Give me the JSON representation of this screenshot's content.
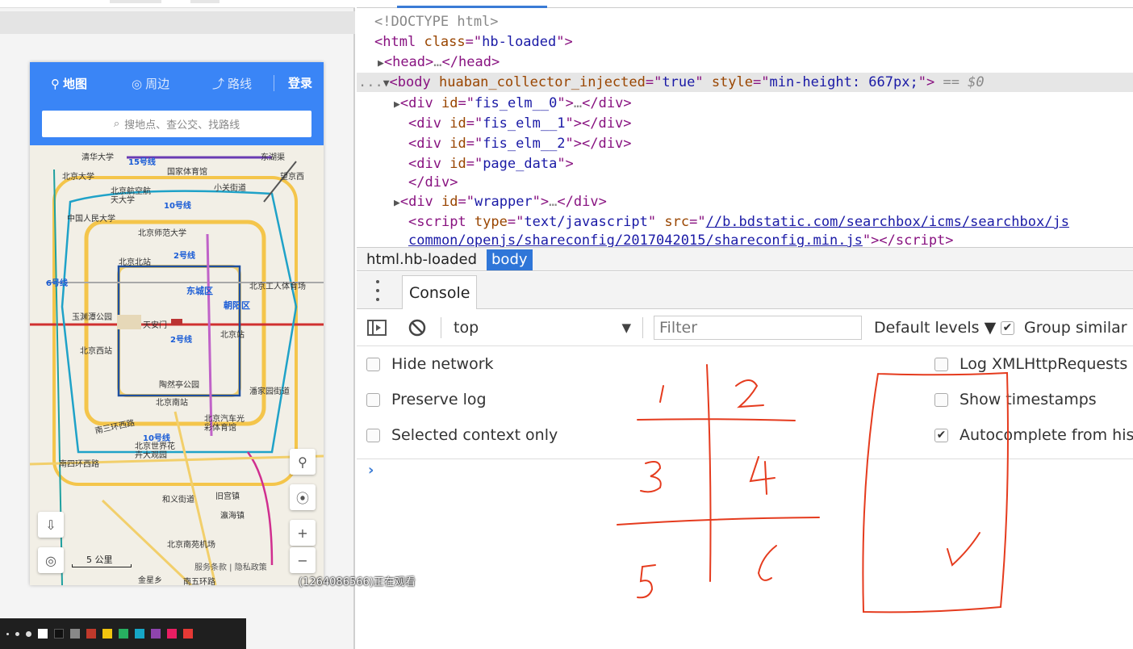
{
  "map": {
    "nav": {
      "map": "地图",
      "nearby": "周边",
      "route": "路线",
      "login": "登录"
    },
    "search_placeholder": "搜地点、查公交、找路线",
    "labels": [
      "清华大学",
      "15号线",
      "东湖渠",
      "北京大学",
      "国家体育馆",
      "望京西",
      "北京航空航天大学",
      "小关街道",
      "10号线",
      "中国人民大学",
      "北京师范大学",
      "北京北站",
      "2号线",
      "北京工人体育场",
      "东城区",
      "朝阳区",
      "6号线",
      "玉渊潭公园",
      "天安门",
      "北京站",
      "北京西站",
      "2号线",
      "陶然亭公园",
      "潘家园街道",
      "北京南站",
      "北京汽车光彩体育馆",
      "南三环西路",
      "10号线",
      "北京世界花卉大观园",
      "南四环西路",
      "和义街道",
      "旧宫镇",
      "瀛海镇",
      "北京南苑机场",
      "金星乡",
      "南五环路"
    ],
    "scale": "5 公里",
    "copyright": "服务条款 | 隐私政策"
  },
  "devtools": {
    "elements": {
      "doctype": "<!DOCTYPE html>",
      "html_open": {
        "tag": "html",
        "attr": "class",
        "value": "hb-loaded"
      },
      "head": {
        "tag": "head",
        "collapsed": "…"
      },
      "body": {
        "tag": "body",
        "attr1": "huaban_collector_injected",
        "val1": "true",
        "attr2": "style",
        "val2": "min-height: 667px;",
        "marker": "== $0",
        "ellipsis": "..."
      },
      "divs": [
        {
          "id": "fis_elm__0",
          "collapsed": true
        },
        {
          "id": "fis_elm__1",
          "collapsed": false
        },
        {
          "id": "fis_elm__2",
          "collapsed": false
        },
        {
          "id": "page_data",
          "collapsed": false
        },
        {
          "id": "wrapper",
          "collapsed": true
        }
      ],
      "script": {
        "type": "text/javascript",
        "src_line1": "//b.bdstatic.com/searchbox/icms/searchbox/js",
        "src_line2": "common/openjs/shareconfig/2017042015/shareconfig.min.js"
      }
    },
    "breadcrumbs": [
      "html.hb-loaded",
      "body"
    ],
    "console_tab": "Console",
    "toolbar": {
      "context": "top",
      "filter_placeholder": "Filter",
      "levels": "Default levels ▼",
      "group_similar": "Group similar"
    },
    "settings_left": [
      {
        "label": "Hide network",
        "checked": false
      },
      {
        "label": "Preserve log",
        "checked": false
      },
      {
        "label": "Selected context only",
        "checked": false
      }
    ],
    "settings_right": [
      {
        "label": "Log XMLHttpRequests",
        "checked": false
      },
      {
        "label": "Show timestamps",
        "checked": false
      },
      {
        "label": "Autocomplete from history",
        "checked": true
      }
    ],
    "prompt": "›"
  },
  "overlay": {
    "watching_text": "(1264086566)正在观看"
  },
  "palette": {
    "colors": [
      "#ffffff",
      "#111111",
      "#888888",
      "#c0392b",
      "#f1c40f",
      "#27ae60",
      "#16a7c7",
      "#8e44ad",
      "#e91e63",
      "#e53935"
    ]
  },
  "colors": {
    "map_header": "#3a85f6",
    "devtools_accent": "#2f76d8",
    "annotation_red": "#e53b1e"
  }
}
